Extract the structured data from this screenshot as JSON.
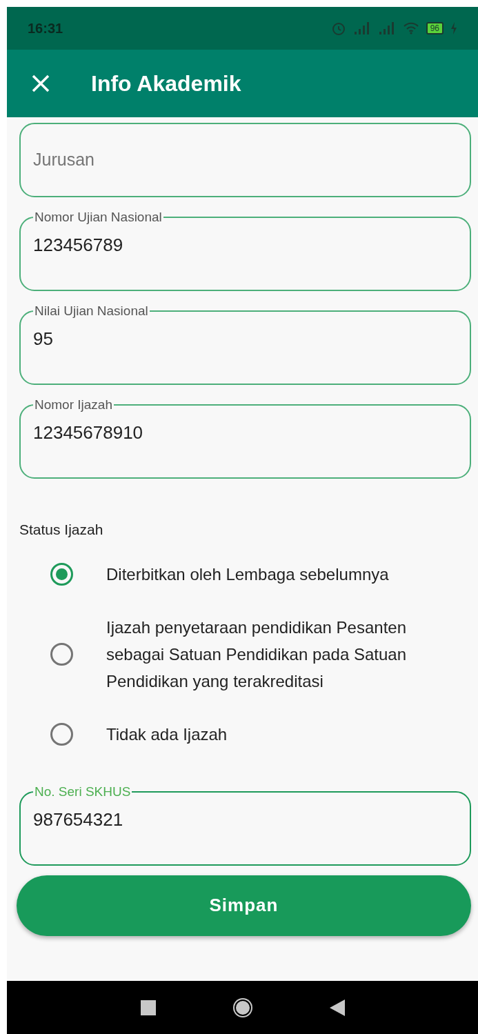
{
  "status_bar": {
    "time": "16:31",
    "battery": "96"
  },
  "app_bar": {
    "title": "Info Akademik"
  },
  "fields": [
    {
      "kind": "placeholder",
      "placeholder": "Jurusan",
      "focused": false
    },
    {
      "kind": "outlined",
      "label": "Nomor Ujian Nasional",
      "value": "123456789",
      "focused": false
    },
    {
      "kind": "outlined",
      "label": "Nilai Ujian Nasional",
      "value": "95",
      "focused": false
    },
    {
      "kind": "outlined",
      "label": "Nomor Ijazah",
      "value": "12345678910",
      "focused": false
    }
  ],
  "status_ijazah": {
    "label": "Status Ijazah",
    "options": [
      {
        "label": "Diterbitkan oleh Lembaga sebelumnya",
        "selected": true
      },
      {
        "label": "Ijazah penyetaraan pendidikan Pesanten sebagai Satuan Pendidikan pada Satuan Pendidikan yang terakreditasi",
        "selected": false
      },
      {
        "label": "Tidak ada Ijazah",
        "selected": false
      }
    ]
  },
  "fields_2": [
    {
      "kind": "outlined",
      "label": "No. Seri SKHUS",
      "value": "987654321",
      "focused": true
    }
  ],
  "save_button": "Simpan"
}
